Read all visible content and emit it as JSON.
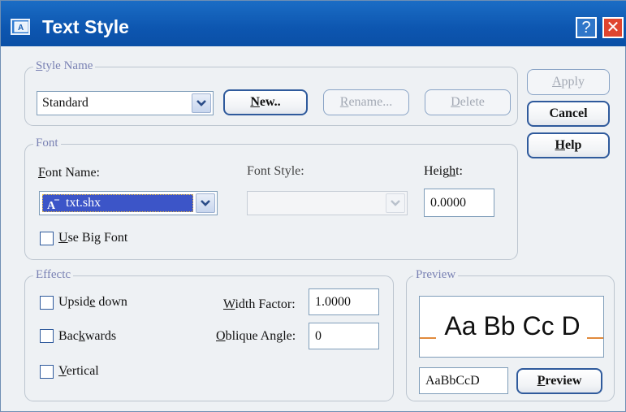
{
  "window": {
    "title": "Text Style",
    "help_symbol": "?",
    "close_symbol": "✕"
  },
  "style_name": {
    "legend": "Style Name",
    "selected": "Standard",
    "new_label": "New..",
    "rename_label": "Rename...",
    "delete_label": "Delete"
  },
  "actions": {
    "apply_label": "Apply",
    "cancel_label": "Cancel",
    "help_label": "Help"
  },
  "font": {
    "legend": "Font",
    "font_name_label": "Font Name:",
    "font_name_value": "txt.shx",
    "font_style_label": "Font Style:",
    "font_style_value": "",
    "height_label": "Height:",
    "height_value": "0.0000",
    "big_font_label": "Use Big Font",
    "big_font_checked": false
  },
  "effects": {
    "legend": "Effectc",
    "upside_down_label": "Upside down",
    "backwards_label": "Backwards",
    "vertical_label": "Vertical",
    "width_factor_label": "Width Factor:",
    "width_factor_value": "1.0000",
    "oblique_label": "Oblique Angle:",
    "oblique_value": "0"
  },
  "preview": {
    "legend": "Preview",
    "sample_text": "Aa Bb Cc D",
    "input_value": "AaBbCcD",
    "button_label": "Preview"
  },
  "colors": {
    "titlebar": "#0d56b0",
    "accent_border": "#2f5a9c",
    "selection": "#3c55c8",
    "close": "#e0452f"
  }
}
